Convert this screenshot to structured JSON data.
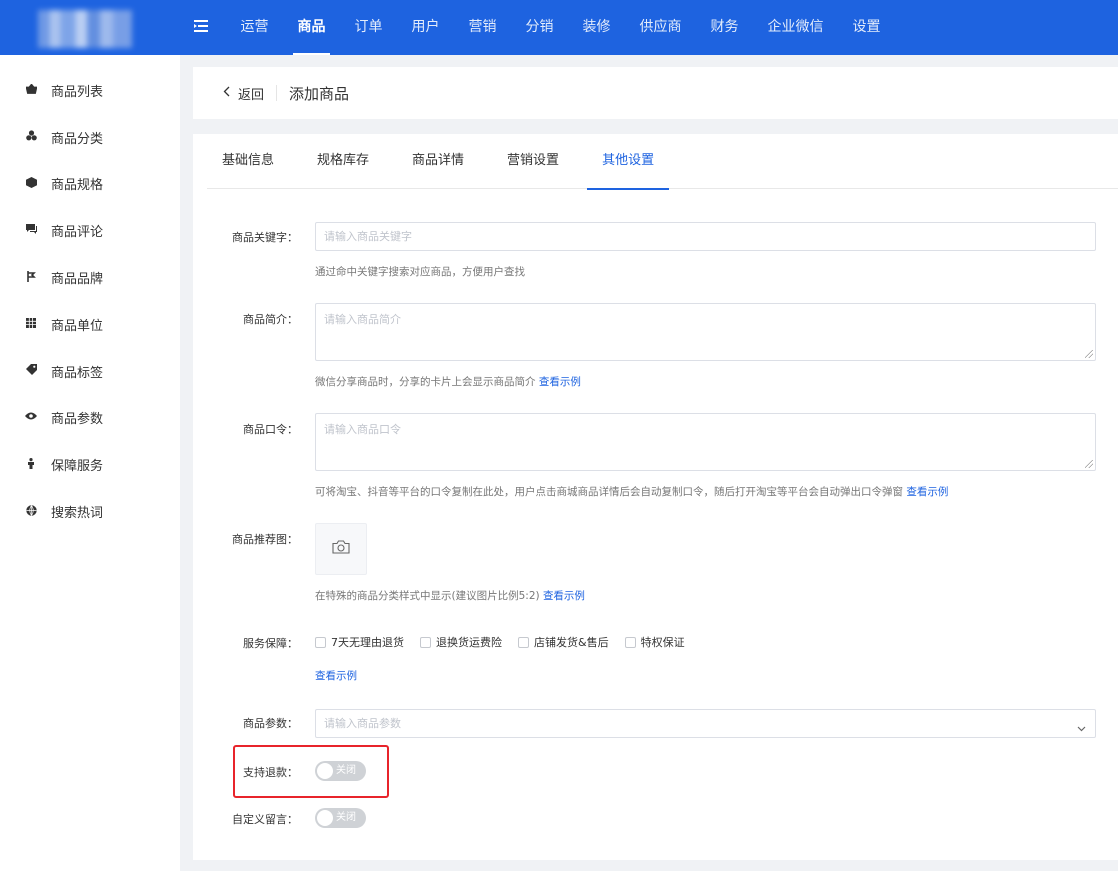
{
  "topnav": {
    "items": [
      "运营",
      "商品",
      "订单",
      "用户",
      "营销",
      "分销",
      "装修",
      "供应商",
      "财务",
      "企业微信",
      "设置"
    ],
    "active": "商品"
  },
  "sidebar": {
    "items": [
      {
        "label": "商品列表",
        "icon": "basket-icon"
      },
      {
        "label": "商品分类",
        "icon": "category-icon"
      },
      {
        "label": "商品规格",
        "icon": "cube-icon"
      },
      {
        "label": "商品评论",
        "icon": "comment-icon"
      },
      {
        "label": "商品品牌",
        "icon": "brand-icon"
      },
      {
        "label": "商品单位",
        "icon": "grid-icon"
      },
      {
        "label": "商品标签",
        "icon": "tag-icon"
      },
      {
        "label": "商品参数",
        "icon": "eye-icon"
      },
      {
        "label": "保障服务",
        "icon": "person-icon"
      },
      {
        "label": "搜索热词",
        "icon": "globe-icon"
      }
    ]
  },
  "header": {
    "back_label": "返回",
    "title": "添加商品"
  },
  "tabs": [
    "基础信息",
    "规格库存",
    "商品详情",
    "营销设置",
    "其他设置"
  ],
  "active_tab": "其他设置",
  "form": {
    "keywords": {
      "label": "商品关键字：",
      "placeholder": "请输入商品关键字",
      "hint": "通过命中关键字搜索对应商品，方便用户查找"
    },
    "intro": {
      "label": "商品简介：",
      "placeholder": "请输入商品简介",
      "hint": "微信分享商品时，分享的卡片上会显示商品简介",
      "link": "查看示例"
    },
    "password": {
      "label": "商品口令：",
      "placeholder": "请输入商品口令",
      "hint": "可将淘宝、抖音等平台的口令复制在此处，用户点击商城商品详情后会自动复制口令，随后打开淘宝等平台会自动弹出口令弹窗",
      "link": "查看示例"
    },
    "recommend_image": {
      "label": "商品推荐图：",
      "hint": "在特殊的商品分类样式中显示(建议图片比例5:2)",
      "link": "查看示例"
    },
    "service": {
      "label": "服务保障：",
      "options": [
        "7天无理由退货",
        "退换货运费险",
        "店铺发货&售后",
        "特权保证"
      ],
      "link": "查看示例"
    },
    "params": {
      "label": "商品参数：",
      "placeholder": "请输入商品参数"
    },
    "refund": {
      "label": "支持退款：",
      "switch_text": "关闭"
    },
    "custom_message": {
      "label": "自定义留言：",
      "switch_text": "关闭"
    }
  }
}
